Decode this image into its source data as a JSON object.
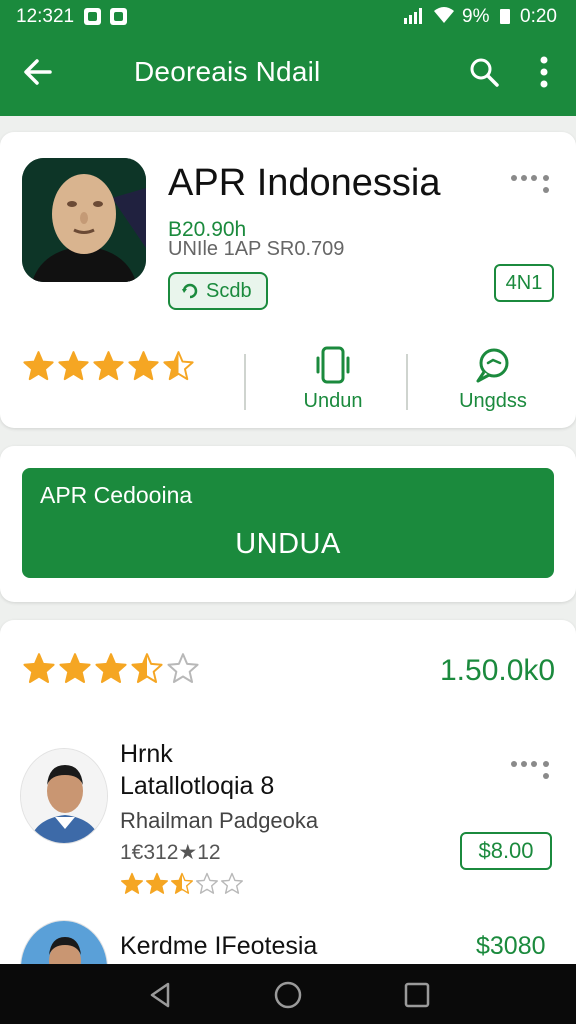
{
  "status_bar": {
    "time": "12:321",
    "battery": "9%",
    "clock": "0:20"
  },
  "app_bar": {
    "title": "Deoreais Ndail",
    "icons": [
      "back-arrow-icon",
      "search-icon",
      "more-vert-icon"
    ]
  },
  "app_info": {
    "name": "APR Indonessia",
    "price": "B20.90h",
    "meta": "UNIle 1AP SR0.709",
    "chip_label": "Scdb",
    "age_badge": "4N1",
    "rating_stars": 4.5,
    "actions": [
      {
        "label": "Undun",
        "icon": "phone-icon"
      },
      {
        "label": "Ungdss",
        "icon": "chat-bubble-icon"
      }
    ]
  },
  "download": {
    "subtitle": "APR Cedooina",
    "button_label": "UNDUA"
  },
  "reviews": {
    "rating_stars": 3.5,
    "rating_count": "1.50.0k0",
    "items": [
      {
        "title_line1": "Hrnk",
        "title_line2": "Latallotloqia 8",
        "name": "Rhailman Padgeoka",
        "date": "1€312★12",
        "stars": 2.5,
        "price": "$8.00"
      },
      {
        "title": "Kerdme IFeotesia",
        "price": "$3080"
      }
    ]
  },
  "colors": {
    "primary": "#1b8a3d",
    "star": "#f5a623",
    "background": "#eef0ee"
  }
}
